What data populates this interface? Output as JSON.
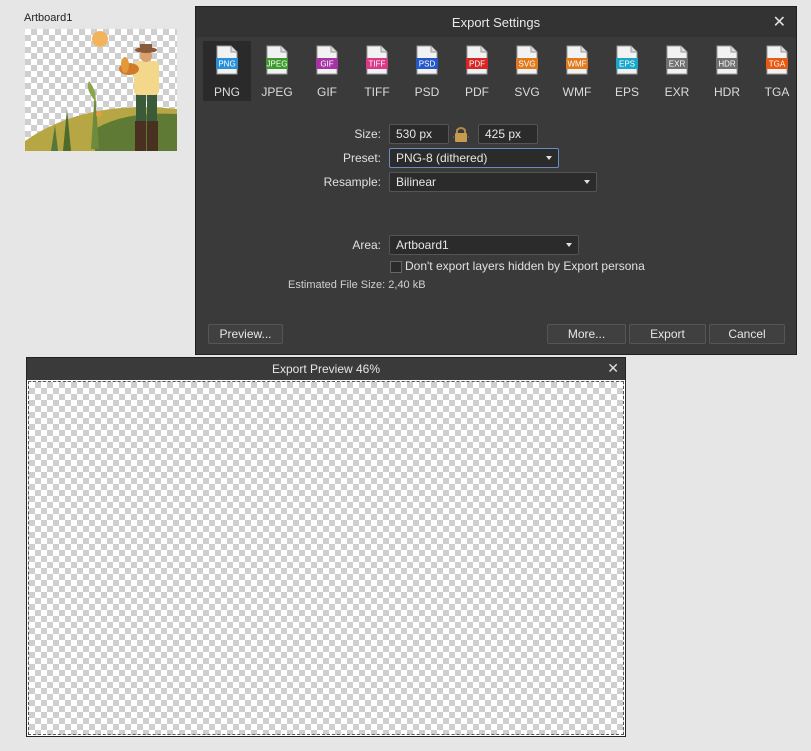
{
  "artboard": {
    "label": "Artboard1"
  },
  "dialog": {
    "title": "Export Settings",
    "close_glyph": "✕",
    "formats": [
      {
        "name": "PNG",
        "color": "#2a8fd8"
      },
      {
        "name": "JPEG",
        "color": "#3e9a2d"
      },
      {
        "name": "GIF",
        "color": "#a535a5"
      },
      {
        "name": "TIFF",
        "color": "#d83a86"
      },
      {
        "name": "PSD",
        "color": "#2457c8"
      },
      {
        "name": "PDF",
        "color": "#d82626"
      },
      {
        "name": "SVG",
        "color": "#e07a1e"
      },
      {
        "name": "WMF",
        "color": "#e07a1e"
      },
      {
        "name": "EPS",
        "color": "#1aa6c8"
      },
      {
        "name": "EXR",
        "color": "#707070"
      },
      {
        "name": "HDR",
        "color": "#707070"
      },
      {
        "name": "TGA",
        "color": "#e85a14"
      }
    ],
    "selected_format": "PNG",
    "size_label": "Size:",
    "width": "530 px",
    "height": "425 px",
    "preset_label": "Preset:",
    "preset_value": "PNG-8 (dithered)",
    "resample_label": "Resample:",
    "resample_value": "Bilinear",
    "area_label": "Area:",
    "area_value": "Artboard1",
    "hidden_layers_label": "Don't export layers hidden by Export persona",
    "estimated_size_label": "Estimated File Size:",
    "estimated_size_value": "2,40 kB",
    "buttons": {
      "preview": "Preview...",
      "more": "More...",
      "export": "Export",
      "cancel": "Cancel"
    }
  },
  "preview": {
    "title": "Export Preview 46%",
    "close_glyph": "✕"
  }
}
